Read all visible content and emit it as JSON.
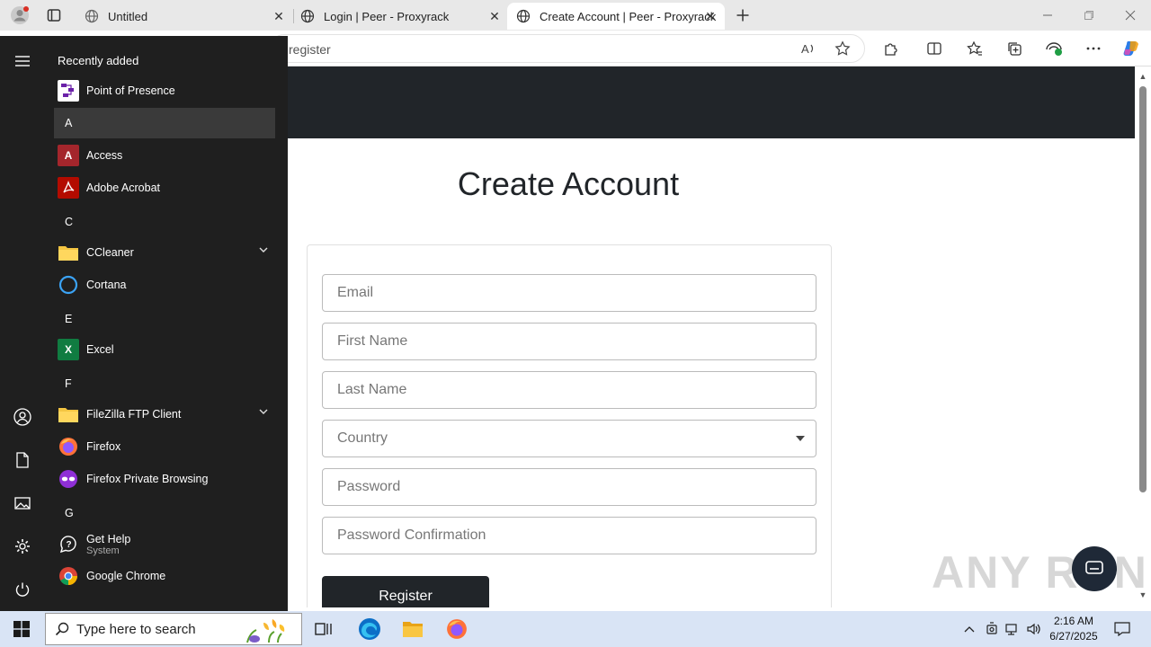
{
  "browser": {
    "tabs": [
      {
        "label": "Untitled"
      },
      {
        "label": "Login | Peer - Proxyrack"
      },
      {
        "label": "Create Account | Peer - Proxyrack"
      }
    ],
    "address": "register"
  },
  "page": {
    "title": "Create Account",
    "fields": {
      "email": "Email",
      "first_name": "First Name",
      "last_name": "Last Name",
      "country": "Country",
      "password": "Password",
      "password_confirmation": "Password Confirmation"
    },
    "register_label": "Register"
  },
  "watermark": "ANY RUN",
  "start_menu": {
    "header": "Recently added",
    "items": [
      {
        "type": "app",
        "name": "Point of Presence"
      },
      {
        "type": "letter",
        "name": "A"
      },
      {
        "type": "app",
        "name": "Access"
      },
      {
        "type": "app",
        "name": "Adobe Acrobat"
      },
      {
        "type": "letter",
        "name": "C"
      },
      {
        "type": "app",
        "name": "CCleaner"
      },
      {
        "type": "app",
        "name": "Cortana"
      },
      {
        "type": "letter",
        "name": "E"
      },
      {
        "type": "app",
        "name": "Excel"
      },
      {
        "type": "letter",
        "name": "F"
      },
      {
        "type": "app",
        "name": "FileZilla FTP Client"
      },
      {
        "type": "app",
        "name": "Firefox"
      },
      {
        "type": "app",
        "name": "Firefox Private Browsing"
      },
      {
        "type": "letter",
        "name": "G"
      },
      {
        "type": "app",
        "name": "Get Help",
        "sub": "System"
      },
      {
        "type": "app",
        "name": "Google Chrome"
      }
    ]
  },
  "taskbar": {
    "search_placeholder": "Type here to search",
    "time": "2:16 AM",
    "date": "6/27/2025"
  }
}
